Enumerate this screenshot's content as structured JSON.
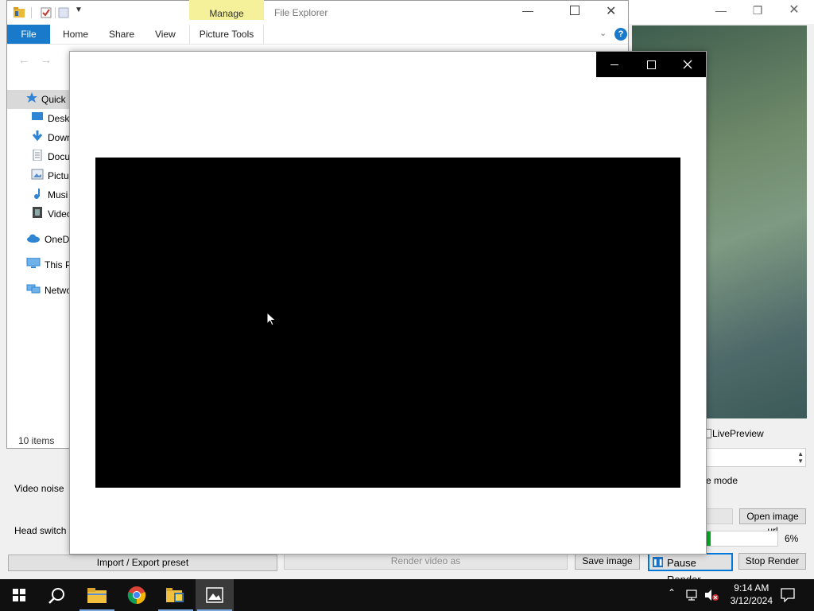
{
  "background_app": {
    "live_preview_label": "LivePreview",
    "mode_label": "e mode",
    "video_noise_label": "Video noise",
    "head_switch_label": "Head switch m",
    "open_image_url": "Open image url",
    "progress_text": "6%",
    "progress": 0.06,
    "import_export_preset": "Import / Export preset",
    "render_video_as": "Render video as",
    "save_image": "Save image",
    "pause_render": "Pause Render",
    "stop_render": "Stop Render"
  },
  "file_explorer": {
    "title": "File Explorer",
    "context_tab": "Manage",
    "tabs": [
      "File",
      "Home",
      "Share",
      "View",
      "Picture Tools"
    ],
    "nav_items": [
      {
        "label": "Quick",
        "icon": "star-icon"
      },
      {
        "label": "Deskt",
        "icon": "desktop-icon"
      },
      {
        "label": "Down",
        "icon": "download-icon"
      },
      {
        "label": "Docu",
        "icon": "document-icon"
      },
      {
        "label": "Pictu",
        "icon": "pictures-icon"
      },
      {
        "label": "Musi",
        "icon": "music-icon"
      },
      {
        "label": "Video",
        "icon": "video-icon"
      },
      {
        "label": "OneDr",
        "icon": "cloud-icon"
      },
      {
        "label": "This PC",
        "icon": "computer-icon"
      },
      {
        "label": "Netwo",
        "icon": "network-icon"
      }
    ],
    "status": "10 items"
  },
  "taskbar": {
    "time": "9:14 AM",
    "date": "3/12/2024"
  },
  "colors": {
    "accent": "#1979ca",
    "manage_tab": "#f4f19a",
    "taskbar": "#101010"
  }
}
